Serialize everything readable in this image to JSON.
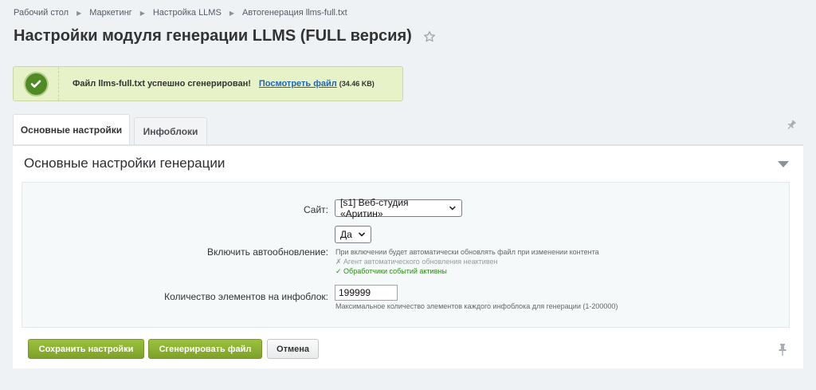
{
  "breadcrumb": {
    "items": [
      {
        "label": "Рабочий стол"
      },
      {
        "label": "Маркетинг"
      },
      {
        "label": "Настройка LLMS"
      },
      {
        "label": "Автогенерация llms-full.txt"
      }
    ]
  },
  "page": {
    "title": "Настройки модуля генерации LLMS (FULL версия)"
  },
  "notice": {
    "message": "Файл llms-full.txt успешно сгенерирован!",
    "link_label": "Посмотреть файл",
    "file_size": "(34.46 KB)"
  },
  "tabs": [
    {
      "label": "Основные настройки",
      "active": true
    },
    {
      "label": "Инфоблоки",
      "active": false
    }
  ],
  "section": {
    "title": "Основные настройки генерации"
  },
  "form": {
    "site": {
      "label": "Сайт:",
      "value": "[s1] Веб-студия «Аритин»"
    },
    "autoupdate": {
      "label": "Включить автообновление:",
      "value": "Да",
      "hint": "При включении будет автоматически обновлять файл при изменении контента",
      "status_agent": "✗ Агент автоматического обновления неактивен",
      "status_handlers": "✓ Обработчики событий активны"
    },
    "count": {
      "label": "Количество элементов на инфоблок:",
      "value": "199999",
      "hint": "Максимальное количество элементов каждого инфоблока для генерации (1-200000)"
    }
  },
  "buttons": {
    "save": "Сохранить настройки",
    "generate": "Сгенерировать файл",
    "cancel": "Отмена"
  },
  "colors": {
    "accent_green": "#86ad2f",
    "link_blue": "#2067b0",
    "success_bg": "#e8f2c9",
    "status_ok": "#2b8a16"
  },
  "icons": [
    "chevron-right-icon",
    "star-icon",
    "checkmark-icon",
    "pin-icon",
    "collapse-arrow-icon",
    "select-chevron-icon"
  ]
}
